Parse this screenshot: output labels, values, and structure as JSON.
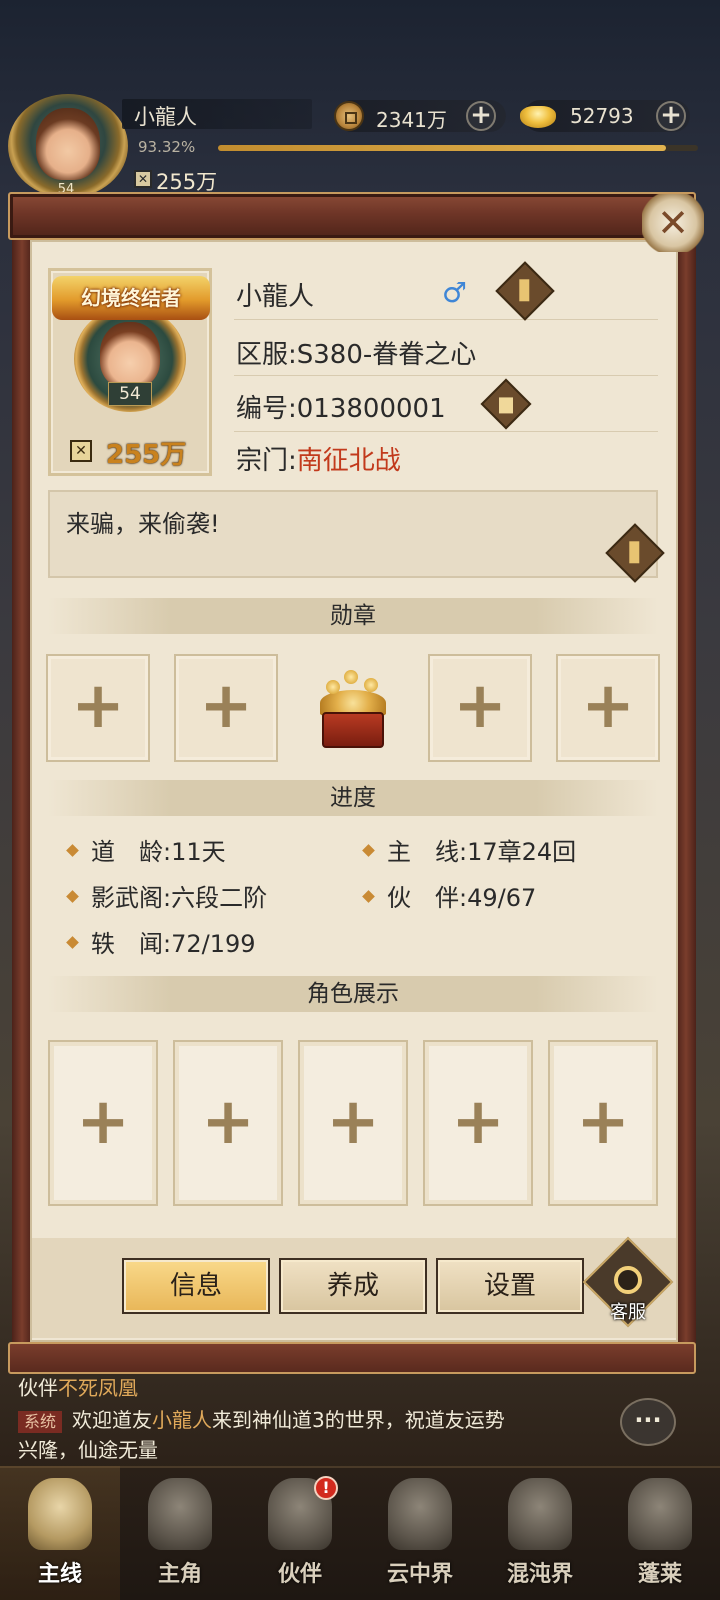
{
  "hud": {
    "name": "小龍人",
    "level": "54",
    "exp_percent": "93.32%",
    "exp_fraction": 0.9332,
    "power": "255万",
    "copper": {
      "value": "2341万",
      "icon": "copper-coin-icon"
    },
    "gold": {
      "value": "52793",
      "icon": "gold-ingot-icon"
    }
  },
  "profile": {
    "title_badge": "幻境终结者",
    "level": "54",
    "power": "255万",
    "name": "小龍人",
    "gender_symbol": "♂",
    "server_label": "区服:",
    "server_value": "S380-眷眷之心",
    "id_label": "编号:",
    "id_value": "013800001",
    "sect_label": "宗门:",
    "sect_value": "南征北战",
    "signature": "来骗，来偷袭!"
  },
  "medals": {
    "title": "勋章",
    "slot_symbol": "+"
  },
  "progress": {
    "title": "进度",
    "items": [
      {
        "label": "道　龄:",
        "value": "11天"
      },
      {
        "label": "主　线:",
        "value": "17章24回"
      },
      {
        "label": "影武阁:",
        "value": "六段二阶"
      },
      {
        "label": "伙　伴:",
        "value": "49/67"
      },
      {
        "label": "轶　闻:",
        "value": "72/199"
      }
    ]
  },
  "showcase": {
    "title": "角色展示",
    "slot_symbol": "+"
  },
  "tabs": [
    {
      "label": "信息",
      "active": true
    },
    {
      "label": "养成",
      "active": false
    },
    {
      "label": "设置",
      "active": false
    }
  ],
  "customer_service": {
    "label": "客服"
  },
  "close_symbol": "✕",
  "chat": {
    "line1_prefix": "伙伴",
    "line1_highlight": "不死凤凰",
    "system_tag": "系统",
    "line2_a": "欢迎道友",
    "line2_name": "小龍人",
    "line2_b": "来到神仙道3的世界，祝道友运势",
    "line3": "兴隆，仙途无量",
    "button_symbol": "···"
  },
  "nav": [
    {
      "label": "主线",
      "active": true,
      "alert": false
    },
    {
      "label": "主角",
      "active": false,
      "alert": false
    },
    {
      "label": "伙伴",
      "active": false,
      "alert": true
    },
    {
      "label": "云中界",
      "active": false,
      "alert": false
    },
    {
      "label": "混沌界",
      "active": false,
      "alert": false
    },
    {
      "label": "蓬莱",
      "active": false,
      "alert": false
    }
  ],
  "nav_alert_symbol": "!",
  "colors": {
    "accent_gold": "#e8b658",
    "sect_red": "#c23a1c",
    "panel_bg": "#efe6d3",
    "frame_red": "#6e3527",
    "gender_blue": "#3f86d6"
  }
}
